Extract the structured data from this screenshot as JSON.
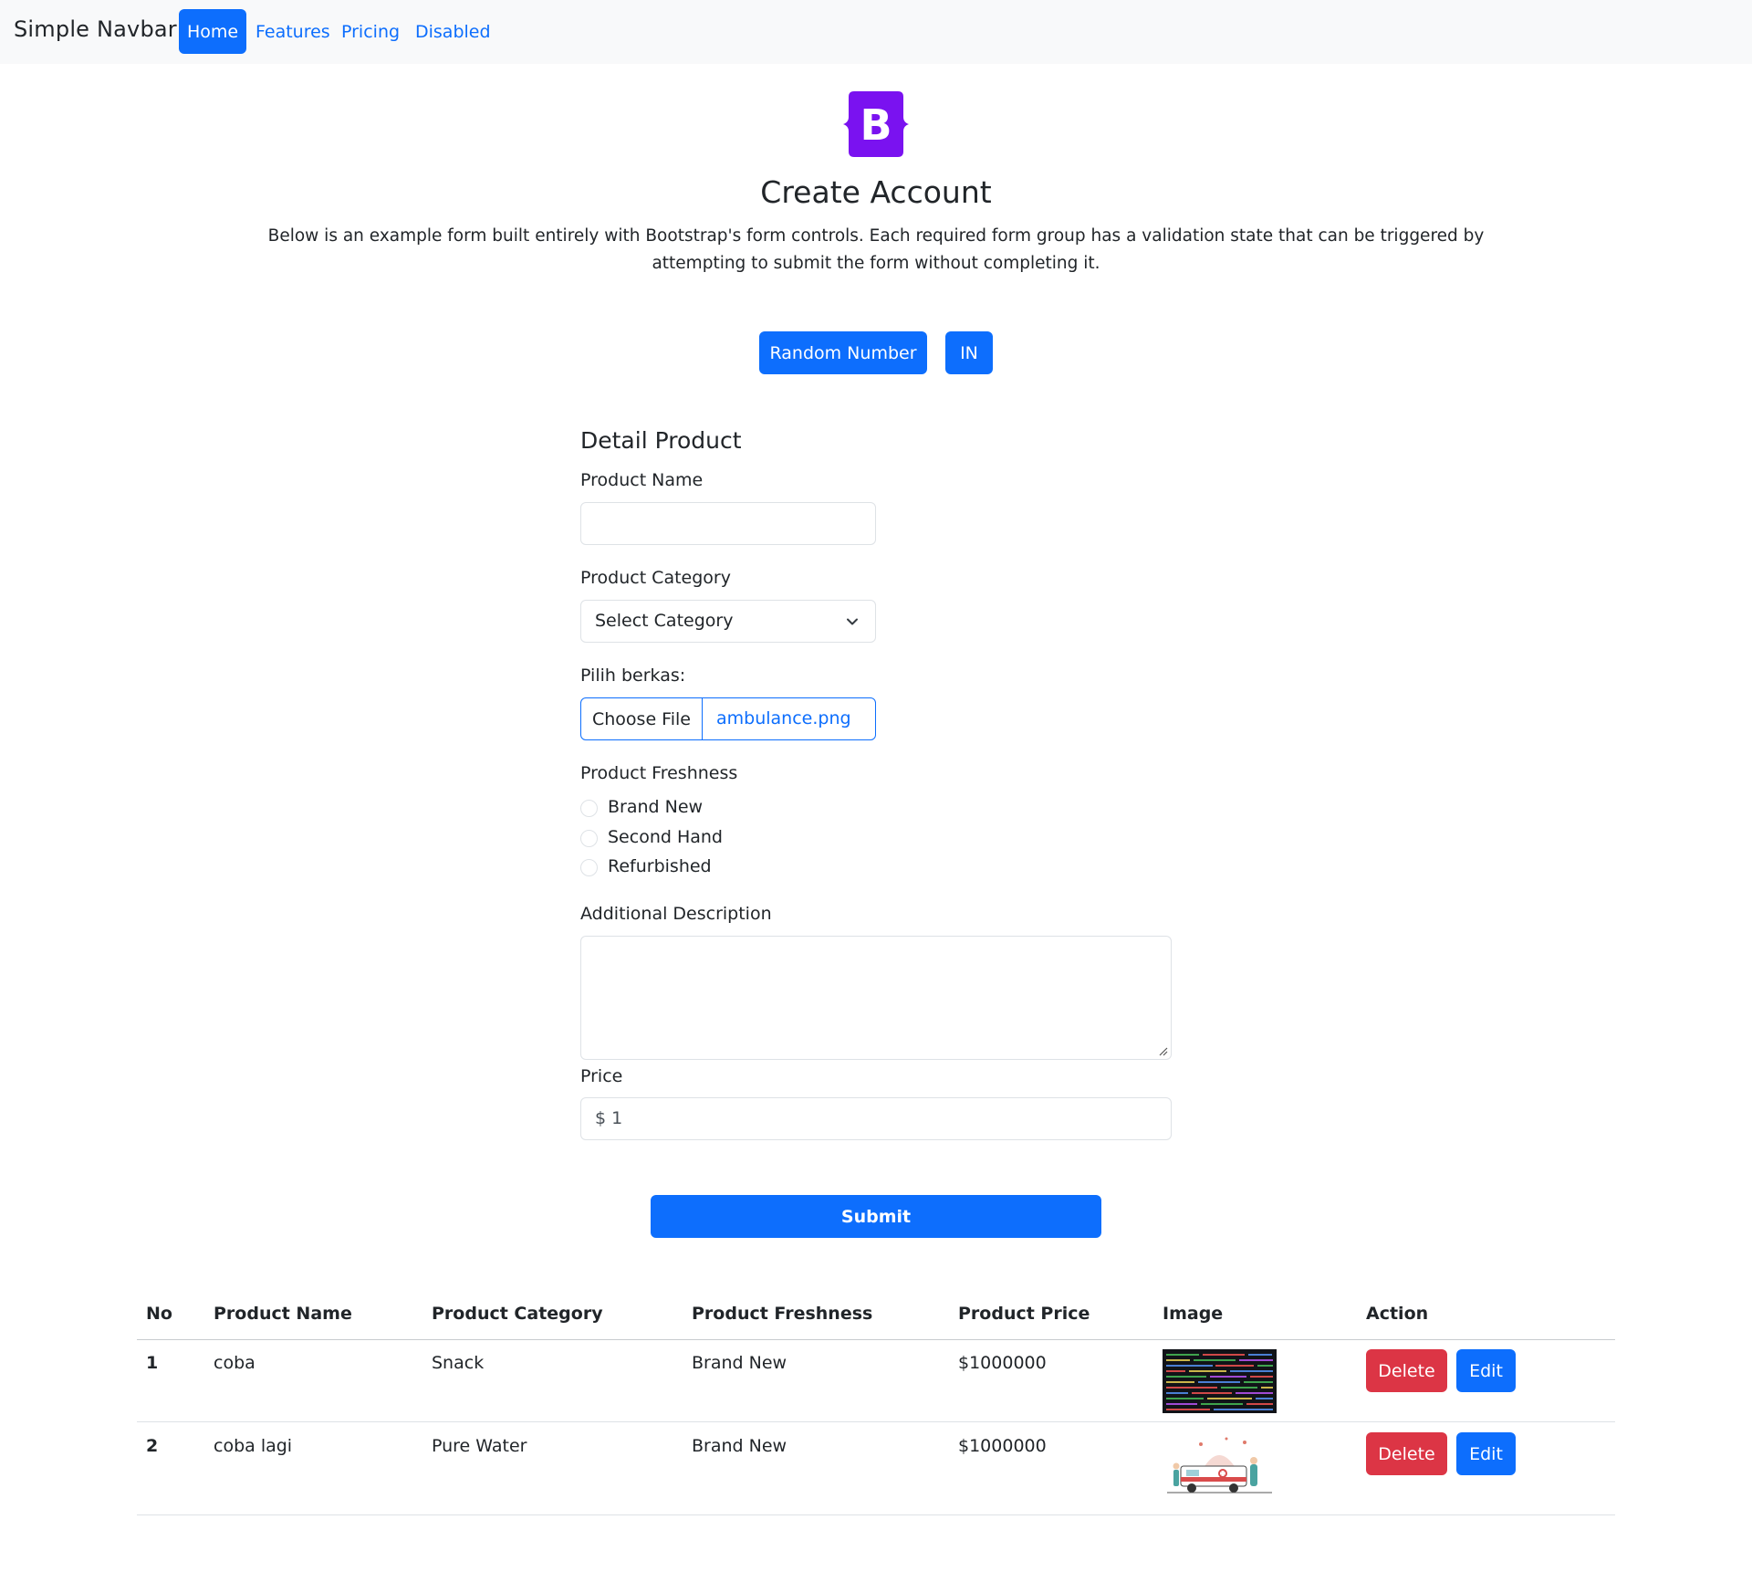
{
  "navbar": {
    "brand": "Simple Navbar",
    "links": [
      "Home",
      "Features",
      "Pricing",
      "Disabled"
    ],
    "active": "Home"
  },
  "logo": {
    "letter": "B",
    "color": "#7a12f0",
    "icon": "bootstrap-logo-icon"
  },
  "header": {
    "title": "Create Account",
    "lead": "Below is an example form built entirely with Bootstrap's form controls. Each required form group has a validation state that can be triggered by attempting to submit the form without completing it."
  },
  "buttons": {
    "random": "Random Number",
    "lang": "IN"
  },
  "form": {
    "section_title": "Detail Product",
    "product_name_label": "Product Name",
    "product_name_value": "",
    "category_label": "Product Category",
    "category_value": "Select Category",
    "file_label": "Pilih berkas:",
    "file_button": "Choose File",
    "file_name": "ambulance.png",
    "freshness_label": "Product Freshness",
    "freshness_options": [
      "Brand New",
      "Second Hand",
      "Refurbished"
    ],
    "description_label": "Additional Description",
    "description_value": "",
    "price_label": "Price",
    "price_value": "$ 1",
    "submit": "Submit"
  },
  "table": {
    "headers": [
      "No",
      "Product Name",
      "Product Category",
      "Product Freshness",
      "Product Price",
      "Image",
      "Action"
    ],
    "rows": [
      {
        "no": "1",
        "name": "coba",
        "category": "Snack",
        "freshness": "Brand New",
        "price": "$1000000",
        "image": "code-screenshot-thumbnail",
        "delete": "Delete",
        "edit": "Edit"
      },
      {
        "no": "2",
        "name": "coba lagi",
        "category": "Pure Water",
        "freshness": "Brand New",
        "price": "$1000000",
        "image": "ambulance-illustration-thumbnail",
        "delete": "Delete",
        "edit": "Edit"
      }
    ]
  },
  "colors": {
    "primary": "#0d6efd",
    "danger": "#dc3545",
    "navbar_bg": "#f8f9fa"
  }
}
